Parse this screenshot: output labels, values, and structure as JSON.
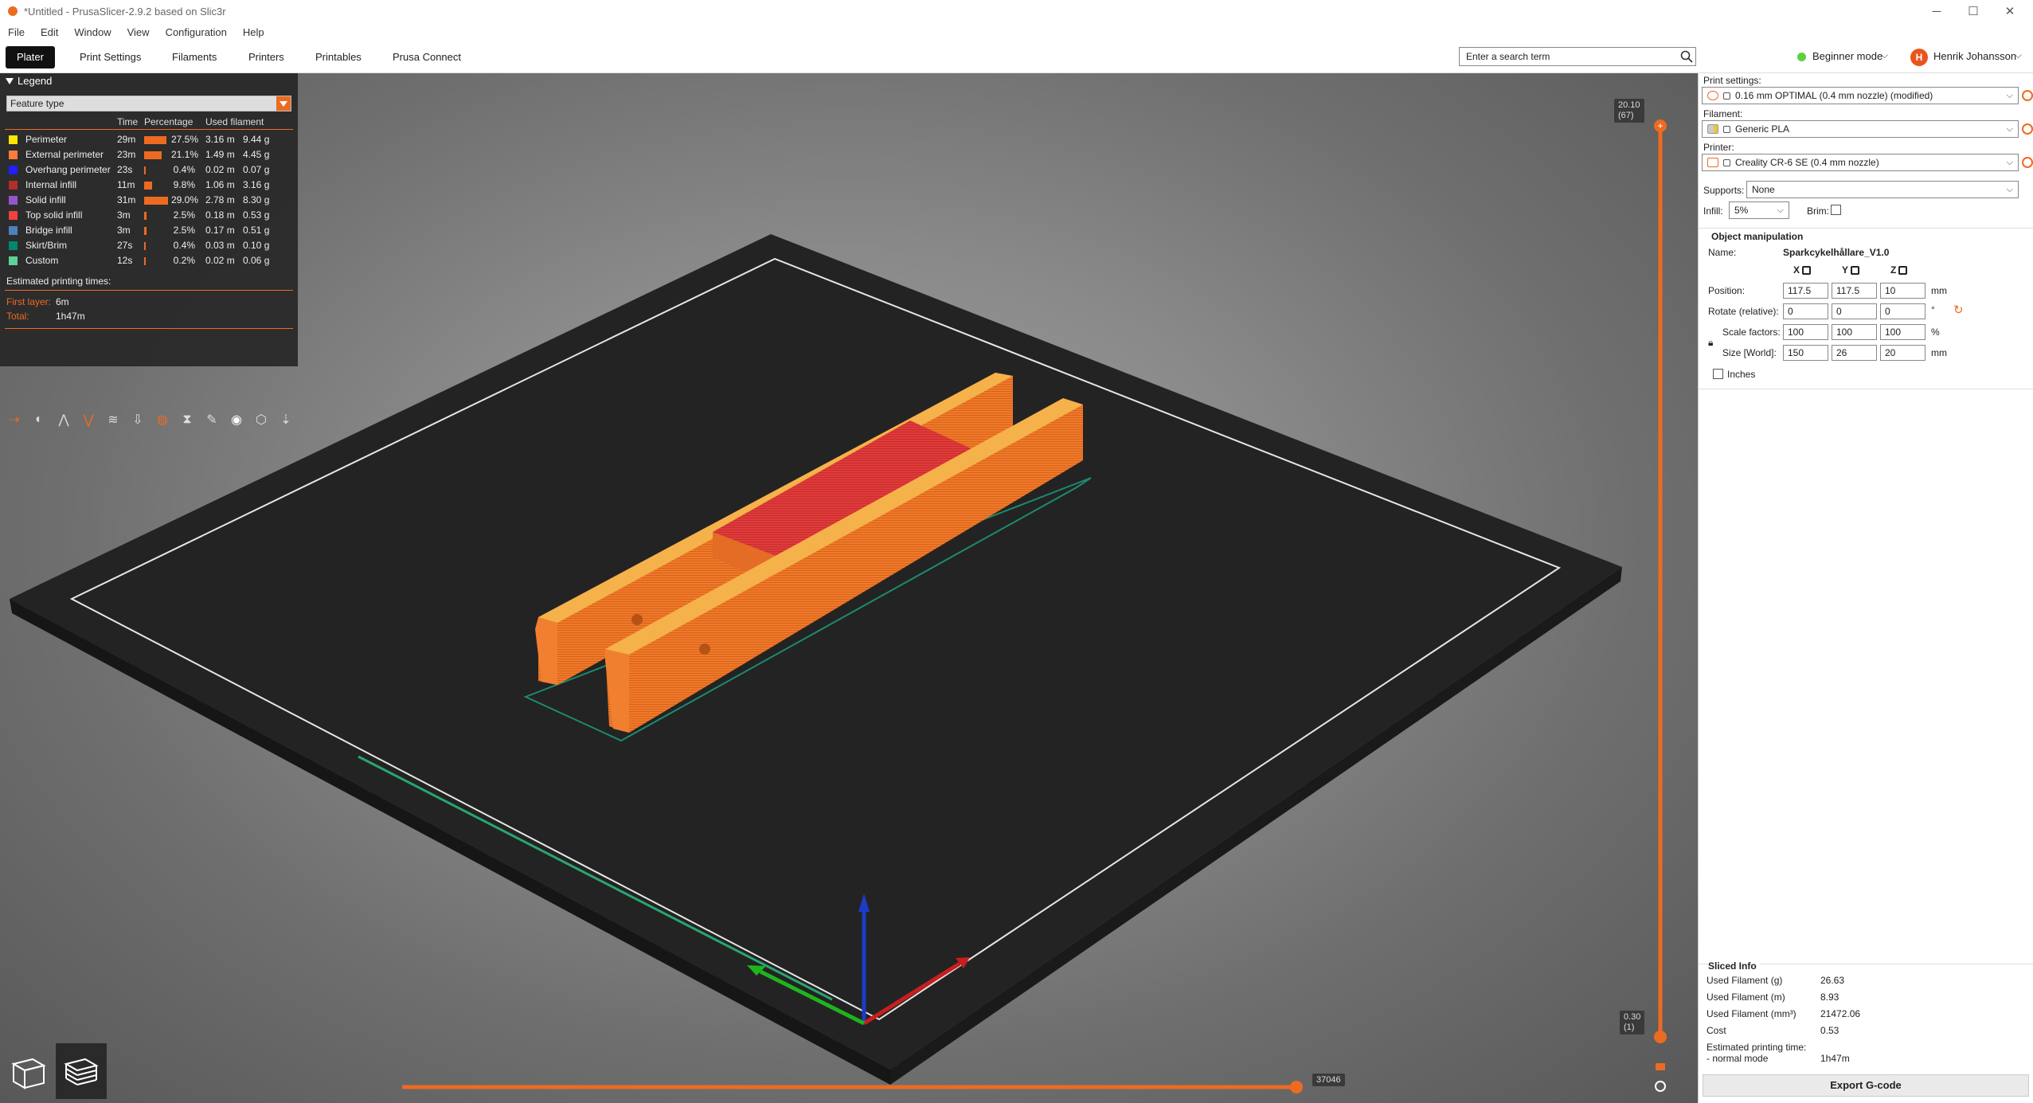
{
  "window": {
    "title": "*Untitled - PrusaSlicer-2.9.2 based on Slic3r",
    "minimize": "─",
    "maximize": "☐",
    "close": "✕"
  },
  "menu": [
    "File",
    "Edit",
    "Window",
    "View",
    "Configuration",
    "Help"
  ],
  "tabs": [
    "Plater",
    "Print Settings",
    "Filaments",
    "Printers",
    "Printables",
    "Prusa Connect"
  ],
  "search": {
    "placeholder": "Enter a search term"
  },
  "mode": {
    "label": "Beginner mode",
    "color": "#5fd03d"
  },
  "user": {
    "initial": "H",
    "name": "Henrik Johansson"
  },
  "legend": {
    "title": "Legend",
    "view_type": "Feature type",
    "columns": {
      "time": "Time",
      "percentage": "Percentage",
      "used_filament": "Used filament"
    },
    "rows": [
      {
        "name": "Perimeter",
        "color": "#ffe600",
        "time": "29m",
        "percent": "27.5%",
        "percent_value": 27.5,
        "length": "3.16 m",
        "weight": "9.44 g"
      },
      {
        "name": "External perimeter",
        "color": "#ff7d38",
        "time": "23m",
        "percent": "21.1%",
        "percent_value": 21.1,
        "length": "1.49 m",
        "weight": "4.45 g"
      },
      {
        "name": "Overhang perimeter",
        "color": "#1f1fff",
        "time": "23s",
        "percent": "0.4%",
        "percent_value": 0.4,
        "length": "0.02 m",
        "weight": "0.07 g"
      },
      {
        "name": "Internal infill",
        "color": "#b03029",
        "time": "11m",
        "percent": "9.8%",
        "percent_value": 9.8,
        "length": "1.06 m",
        "weight": "3.16 g"
      },
      {
        "name": "Solid infill",
        "color": "#9654cc",
        "time": "31m",
        "percent": "29.0%",
        "percent_value": 29.0,
        "length": "2.78 m",
        "weight": "8.30 g"
      },
      {
        "name": "Top solid infill",
        "color": "#f04040",
        "time": "3m",
        "percent": "2.5%",
        "percent_value": 2.5,
        "length": "0.18 m",
        "weight": "0.53 g"
      },
      {
        "name": "Bridge infill",
        "color": "#4d80ba",
        "time": "3m",
        "percent": "2.5%",
        "percent_value": 2.5,
        "length": "0.17 m",
        "weight": "0.51 g"
      },
      {
        "name": "Skirt/Brim",
        "color": "#00876e",
        "time": "27s",
        "percent": "0.4%",
        "percent_value": 0.4,
        "length": "0.03 m",
        "weight": "0.10 g"
      },
      {
        "name": "Custom",
        "color": "#5ed194",
        "time": "12s",
        "percent": "0.2%",
        "percent_value": 0.2,
        "length": "0.02 m",
        "weight": "0.06 g"
      }
    ],
    "estimated_title": "Estimated printing times:",
    "first_layer_label": "First layer:",
    "first_layer_value": "6m",
    "total_label": "Total:",
    "total_value": "1h47m"
  },
  "vslider": {
    "top_label": "20.10\n(67)",
    "bottom_label": "0.30\n(1)"
  },
  "hslider": {
    "label": "37046",
    "fraction": 0.94
  },
  "sidebar": {
    "print_settings_label": "Print settings:",
    "print_settings_value": "0.16 mm OPTIMAL (0.4 mm nozzle) (modified)",
    "filament_label": "Filament:",
    "filament_value": "Generic PLA",
    "printer_label": "Printer:",
    "printer_value": "Creality CR-6 SE (0.4 mm nozzle)",
    "supports_label": "Supports:",
    "supports_value": "None",
    "infill_label": "Infill:",
    "infill_value": "5%",
    "brim_label": "Brim:"
  },
  "object_manipulation": {
    "title": "Object manipulation",
    "name_label": "Name:",
    "name_value": "Sparkcykelhållare_V1.0",
    "axes": [
      "X",
      "Y",
      "Z"
    ],
    "position_label": "Position:",
    "position": [
      "117.5",
      "117.5",
      "10"
    ],
    "position_unit": "mm",
    "rotate_label": "Rotate (relative):",
    "rotate": [
      "0",
      "0",
      "0"
    ],
    "rotate_unit": "°",
    "scale_label": "Scale factors:",
    "scale": [
      "100",
      "100",
      "100"
    ],
    "scale_unit": "%",
    "size_label": "Size [World]:",
    "size": [
      "150",
      "26",
      "20"
    ],
    "size_unit": "mm",
    "inches_label": "Inches"
  },
  "sliced_info": {
    "title": "Sliced Info",
    "rows": [
      {
        "label": "Used Filament (g)",
        "value": "26.63"
      },
      {
        "label": "Used Filament (m)",
        "value": "8.93"
      },
      {
        "label": "Used Filament (mm³)",
        "value": "21472.06"
      },
      {
        "label": "Cost",
        "value": "0.53"
      }
    ],
    "time_label": "Estimated printing time:",
    "mode_label": "- normal mode",
    "mode_value": "1h47m"
  },
  "export_label": "Export G-code",
  "accent_color": "#ed6b21"
}
